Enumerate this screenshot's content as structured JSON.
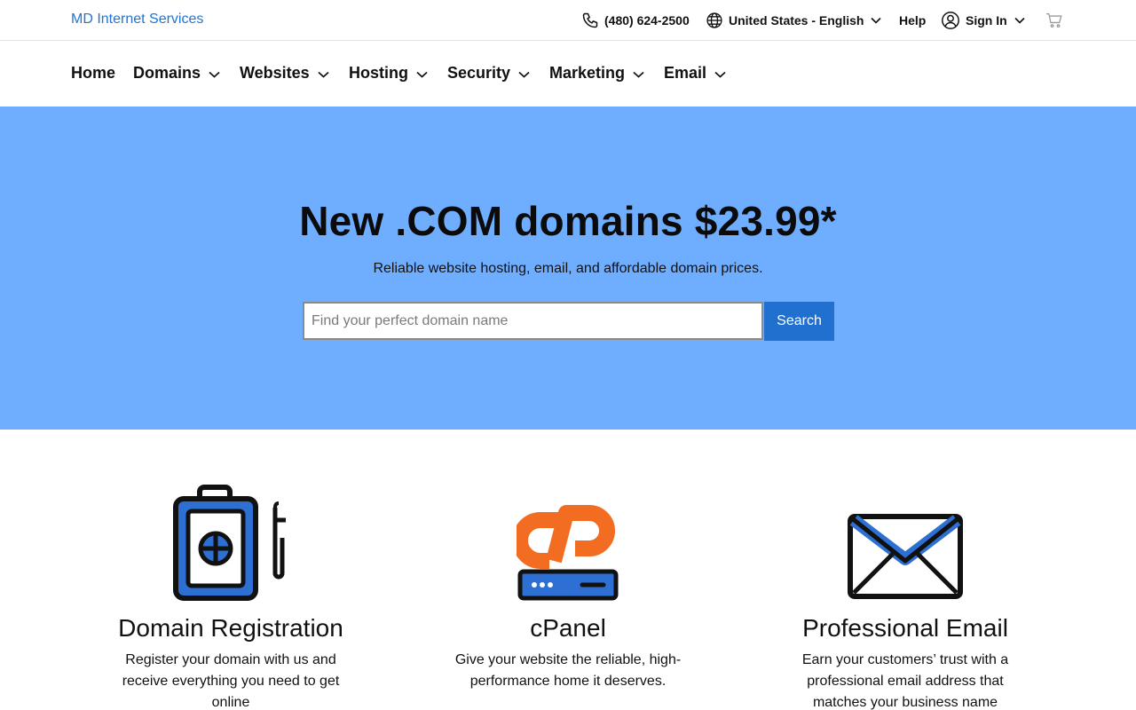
{
  "brand": "MD Internet Services",
  "utility": {
    "phone": "(480) 624-2500",
    "language": "United States - English",
    "help": "Help",
    "sign_in": "Sign In"
  },
  "nav": {
    "items": [
      {
        "label": "Home",
        "has_dropdown": false
      },
      {
        "label": "Domains",
        "has_dropdown": true
      },
      {
        "label": "Websites",
        "has_dropdown": true
      },
      {
        "label": "Hosting",
        "has_dropdown": true
      },
      {
        "label": "Security",
        "has_dropdown": true
      },
      {
        "label": "Marketing",
        "has_dropdown": true
      },
      {
        "label": "Email",
        "has_dropdown": true
      }
    ]
  },
  "hero": {
    "title": "New .COM domains $23.99*",
    "subtitle": "Reliable website hosting, email, and affordable domain prices.",
    "search_placeholder": "Find your perfect domain name",
    "search_value": "",
    "search_button": "Search"
  },
  "features": [
    {
      "icon": "domain-registration-icon",
      "title": "Domain Registration",
      "description": "Register your domain with us and receive everything you need to get online"
    },
    {
      "icon": "cpanel-icon",
      "title": "cPanel",
      "description": "Give your website the reliable, high-performance home it deserves."
    },
    {
      "icon": "email-envelope-icon",
      "title": "Professional Email",
      "description": "Earn your customers’ trust with a professional email address that matches your business name"
    }
  ],
  "colors": {
    "brand_link": "#1f74d4",
    "hero_bg": "#6faeff",
    "button_bg": "#2170cf",
    "icon_blue": "#2d6fd2",
    "cpanel_orange": "#f26d21"
  }
}
